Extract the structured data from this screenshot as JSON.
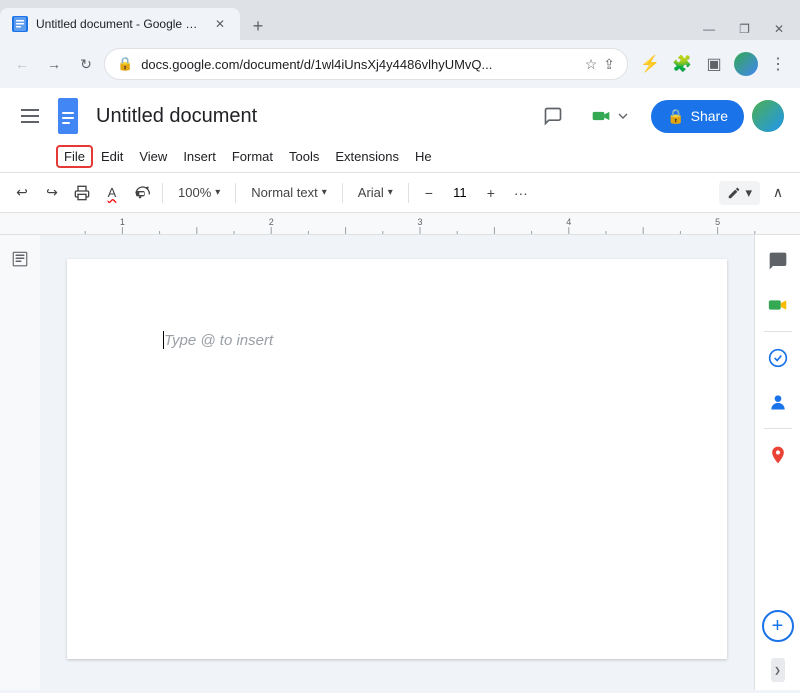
{
  "browser": {
    "tab_title": "Untitled document - Google Do...",
    "tab_favicon": "📄",
    "new_tab_label": "+",
    "window_minimize": "—",
    "window_restore": "❐",
    "window_close": "✕",
    "url": "docs.google.com/document/d/1wl4iUnsXj4y4486vlhyUMvQ...",
    "nav_back_label": "←",
    "nav_forward_label": "→",
    "nav_reload_label": "↻"
  },
  "header": {
    "doc_title": "Untitled document",
    "menu_items": [
      {
        "label": "File",
        "active": true
      },
      {
        "label": "Edit",
        "active": false
      },
      {
        "label": "View",
        "active": false
      },
      {
        "label": "Insert",
        "active": false
      },
      {
        "label": "Format",
        "active": false
      },
      {
        "label": "Tools",
        "active": false
      },
      {
        "label": "Extensions",
        "active": false
      },
      {
        "label": "He",
        "active": false
      }
    ],
    "share_label": "Share",
    "share_icon": "🔒"
  },
  "toolbar": {
    "undo": "↩",
    "redo": "↪",
    "print": "🖨",
    "paint_format": "✎",
    "zoom_value": "100%",
    "style_label": "Normal text",
    "font_label": "Arial",
    "font_size": "11",
    "more_icon": "···",
    "edit_mode": "✏",
    "collapse_chevron": "∧"
  },
  "document": {
    "placeholder": "Type @ to insert"
  },
  "right_panel": {
    "chat_icon": "💬",
    "meet_icon": "📹",
    "tasks_icon": "✓",
    "contacts_icon": "👤",
    "maps_icon": "📍",
    "add_icon": "+",
    "collapse_icon": "❯"
  }
}
